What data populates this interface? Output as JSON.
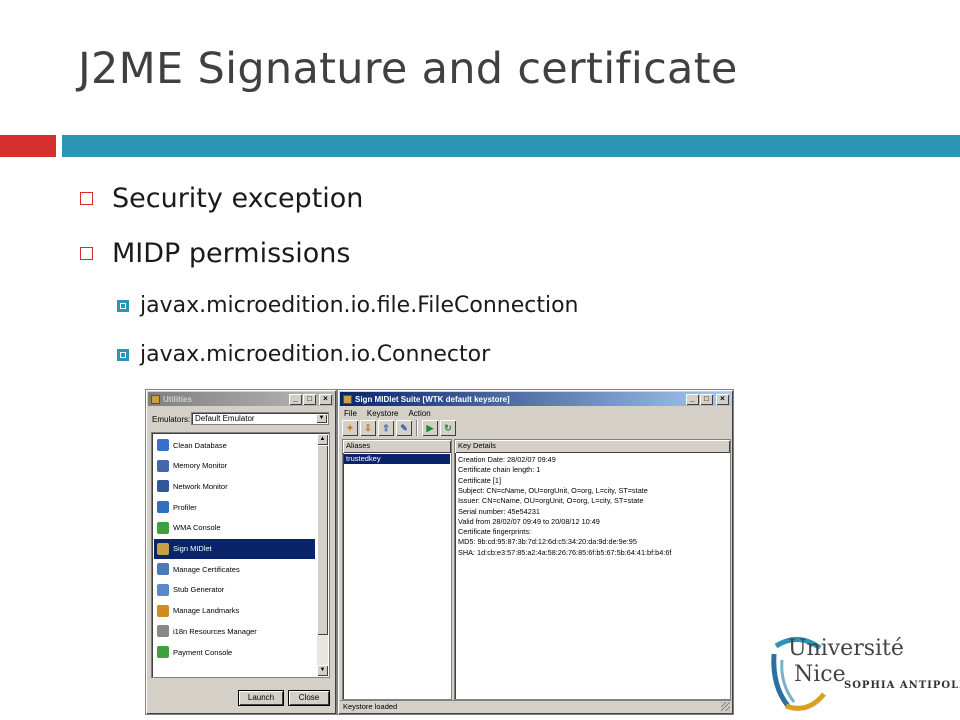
{
  "slide": {
    "title": "J2ME Signature and certificate",
    "accent_red": "#d32f2f",
    "accent_blue": "#2c95b5",
    "bullets": [
      {
        "level": 1,
        "text": "Security exception"
      },
      {
        "level": 1,
        "text": "MIDP permissions"
      },
      {
        "level": 2,
        "text": "javax.microedition.io.file.FileConnection"
      },
      {
        "level": 2,
        "text": "javax.microedition.io.Connector"
      }
    ]
  },
  "utilities_window": {
    "title": "Utilities",
    "caption_buttons": [
      "_",
      "□",
      "×"
    ],
    "emulators_label": "Emulators:",
    "emulators_value": "Default Emulator",
    "items": [
      {
        "label": "Clean Database",
        "icon": "database-icon",
        "color": "#3a6fd0"
      },
      {
        "label": "Memory Monitor",
        "icon": "memory-monitor-icon",
        "color": "#4466aa"
      },
      {
        "label": "Network Monitor",
        "icon": "network-monitor-icon",
        "color": "#335599"
      },
      {
        "label": "Profiler",
        "icon": "profiler-icon",
        "color": "#2f6fbf"
      },
      {
        "label": "WMA Console",
        "icon": "wma-console-icon",
        "color": "#3f9f3f"
      },
      {
        "label": "Sign MIDlet",
        "icon": "sign-midlet-icon",
        "color": "#c8a040",
        "selected": true
      },
      {
        "label": "Manage Certificates",
        "icon": "certificates-icon",
        "color": "#4a7ab8"
      },
      {
        "label": "Stub Generator",
        "icon": "stub-generator-icon",
        "color": "#5a88c8"
      },
      {
        "label": "Manage Landmarks",
        "icon": "landmarks-icon",
        "color": "#d08a20"
      },
      {
        "label": "i18n Resources Manager",
        "icon": "i18n-icon",
        "color": "#888888"
      },
      {
        "label": "Payment Console",
        "icon": "payment-console-icon",
        "color": "#3fa03f"
      }
    ],
    "launch_label": "Launch",
    "close_label": "Close"
  },
  "sign_window": {
    "title": "Sign MIDlet Suite [WTK default keystore]",
    "caption_buttons": [
      "_",
      "□",
      "×"
    ],
    "menu": [
      "File",
      "Keystore",
      "Action"
    ],
    "toolbar_icons": [
      "new-key-icon",
      "import-key-icon",
      "export-key-icon",
      "delete-key-icon",
      "sign-run-icon",
      "refresh-icon"
    ],
    "aliases_header": "Aliases",
    "aliases": [
      "trustedkey"
    ],
    "details_header": "Key Details",
    "details": [
      "Creation Date: 28/02/07 09:49",
      "Certificate chain length: 1",
      "Certificate [1]",
      "Subject: CN=cName, OU=orgUnit, O=org, L=city, ST=state",
      "Issuer: CN=cName, OU=orgUnit, O=org, L=city, ST=state",
      "Serial number: 45e54231",
      "Valid from 28/02/07 09:49 to 20/08/12 10:49",
      "Certificate fingerprints:",
      "  MD5: 9b:cd:95:87:3b:7d:12:6d:c5:34:20:da:9d:de:9e:95",
      "  SHA: 1d:cb:e3:57:85:a2:4a:58:26:76:85:6f:b5:67:5b:64:41:bf:b4:6f"
    ],
    "status": "Keystore loaded"
  },
  "logo": {
    "line1": "Université",
    "line2": "Nice",
    "line3": "SOPHIA ANTIPOLIS"
  }
}
